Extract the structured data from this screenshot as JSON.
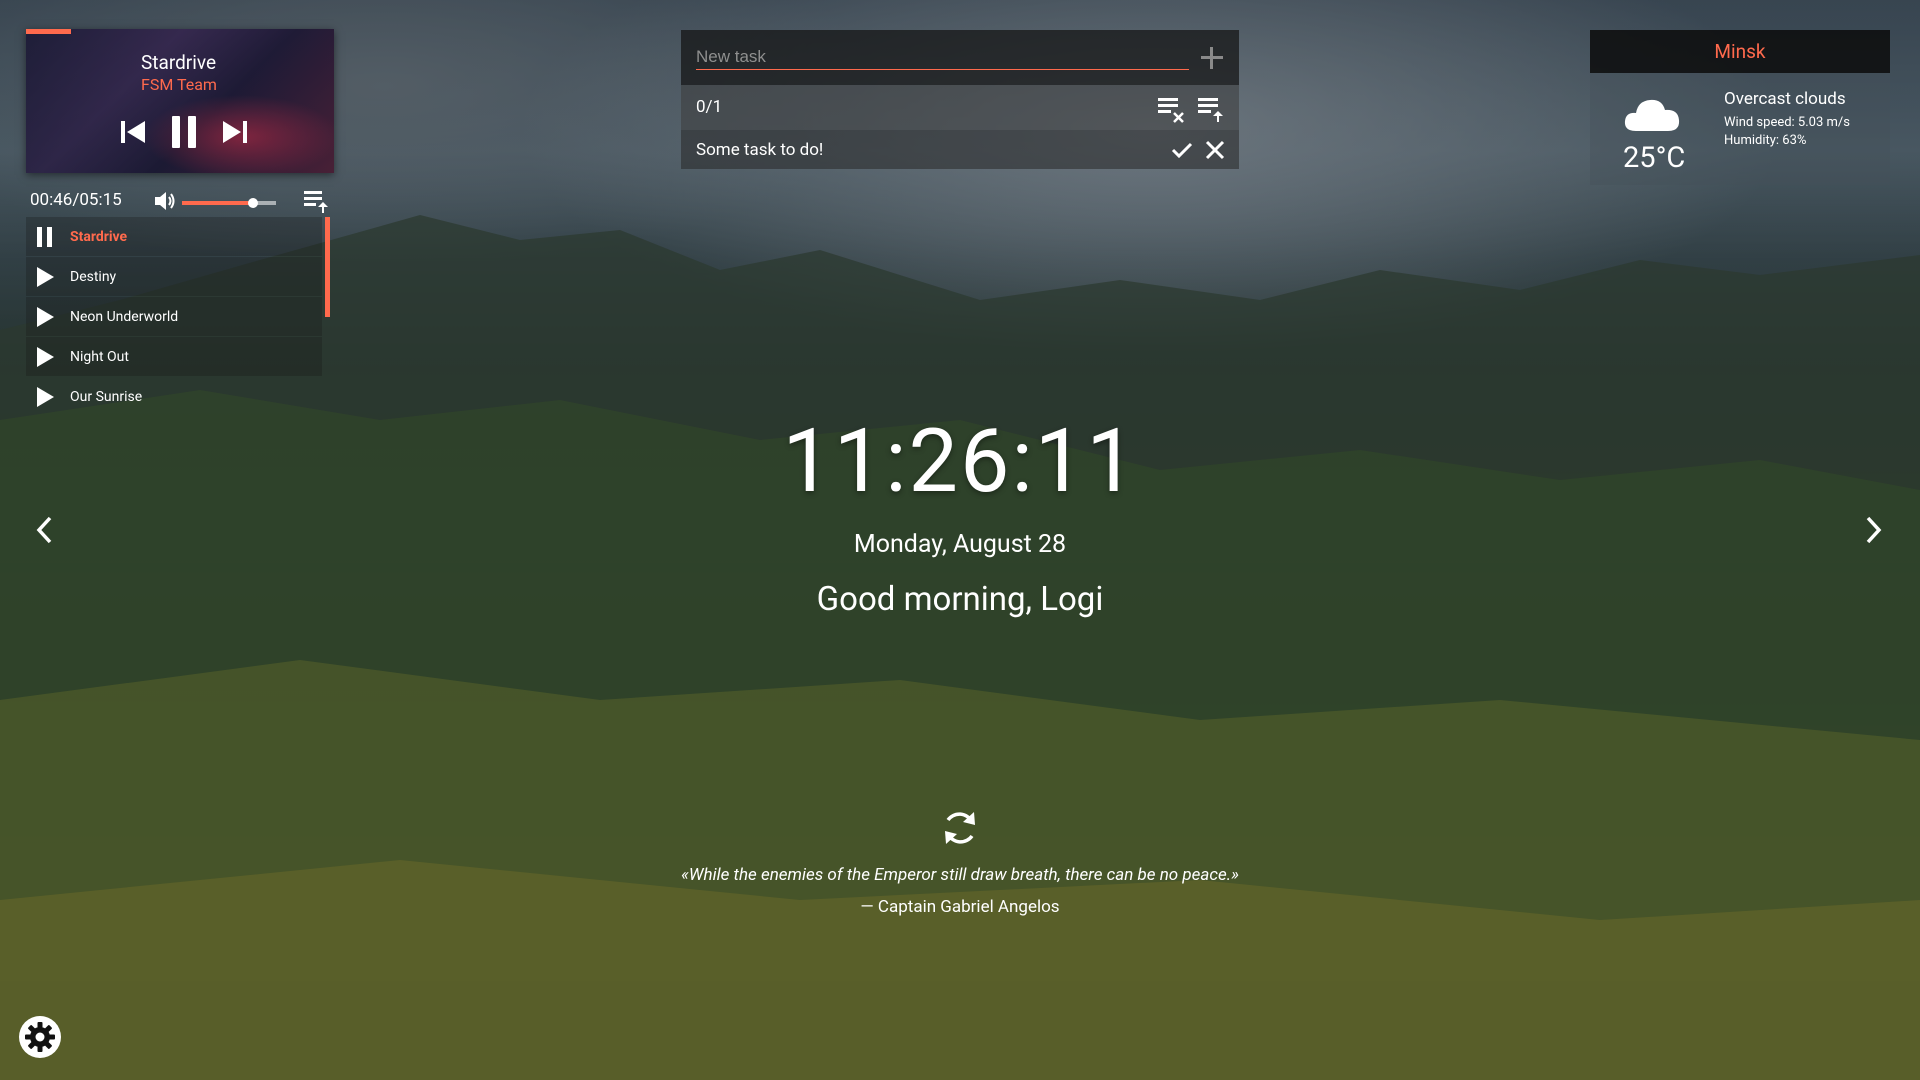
{
  "player": {
    "title": "Stardrive",
    "artist": "FSM Team",
    "time": "00:46/05:15",
    "volume_level": 0.75,
    "progress_fraction": 0.146,
    "playlist": [
      {
        "label": "Stardrive",
        "state": "playing"
      },
      {
        "label": "Destiny",
        "state": "paused"
      },
      {
        "label": "Neon Underworld",
        "state": "paused"
      },
      {
        "label": "Night Out",
        "state": "paused"
      },
      {
        "label": "Our Sunrise",
        "state": "paused"
      }
    ]
  },
  "todo": {
    "placeholder": "New task",
    "count": "0/1",
    "items": [
      {
        "text": "Some task to do!"
      }
    ]
  },
  "weather": {
    "city": "Minsk",
    "temperature": "25°C",
    "description": "Overcast clouds",
    "wind": "Wind speed: 5.03 m/s",
    "humidity": "Humidity: 63%",
    "icon": "cloud-icon"
  },
  "clock": {
    "time": "11:26:11",
    "date": "Monday, August 28",
    "greeting": "Good morning, Logi"
  },
  "quote": {
    "text": "«While the enemies of the Emperor still draw breath, there can be no peace.»",
    "author": "— Captain Gabriel Angelos"
  },
  "colors": {
    "accent": "#ff6a4d",
    "text": "#ffffff"
  }
}
